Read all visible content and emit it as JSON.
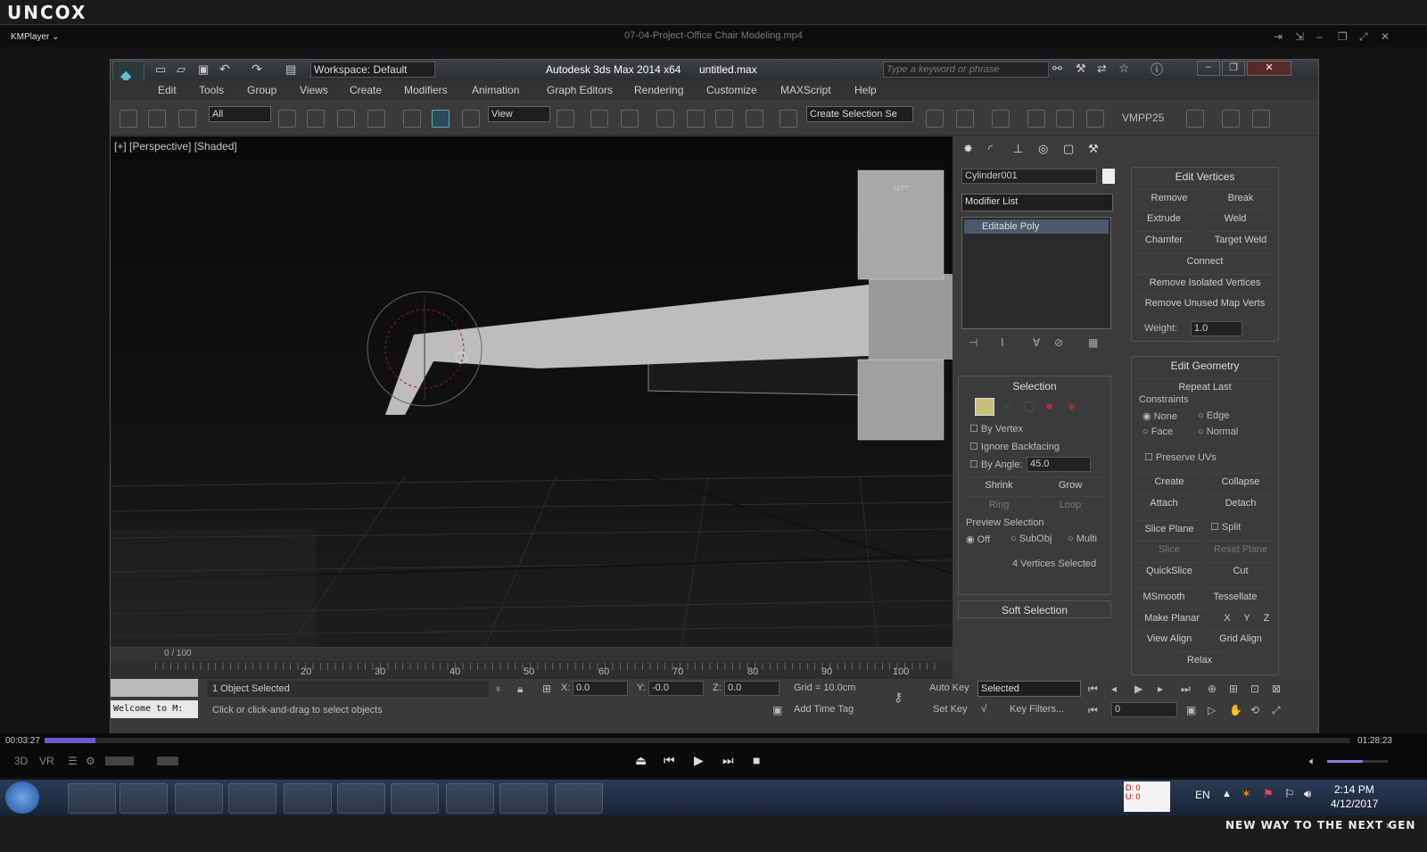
{
  "brand": "uncox",
  "kmplayer": {
    "logo": "KMPlayer",
    "file_title": "07-04-Project-Office Chair Modeling.mp4",
    "time_current": "00:03:27",
    "time_total": "01:28:23",
    "progress": 0.039
  },
  "max": {
    "workspace": "Workspace: Default",
    "title": "Autodesk 3ds Max  2014 x64",
    "filename": "untitled.max",
    "search_placeholder": "Type a keyword or phrase",
    "menus": [
      "Edit",
      "Tools",
      "Group",
      "Views",
      "Create",
      "Modifiers",
      "Animation",
      "Graph Editors",
      "Rendering",
      "Customize",
      "MAXScript",
      "Help"
    ],
    "selection_filter": "All",
    "ref_coord": "View",
    "named_selection": "Create Selection Se",
    "vmpp": "VMPP25"
  },
  "viewport": {
    "label": "[+] [Perspective] [Shaded]",
    "cube_label": "LEFT"
  },
  "cmd": {
    "object_name": "Cylinder001",
    "modifier_list": "Modifier List",
    "stack_item": "Editable Poly",
    "selection": {
      "title": "Selection",
      "by_vertex": "By Vertex",
      "ignore_backfacing": "Ignore Backfacing",
      "by_angle": "By Angle:",
      "angle_value": "45.0",
      "shrink": "Shrink",
      "grow": "Grow",
      "ring": "Ring",
      "loop": "Loop",
      "preview": "Preview Selection",
      "off": "Off",
      "subobj": "SubObj",
      "multi": "Multi",
      "status": "4 Vertices Selected"
    },
    "soft_selection": "Soft Selection",
    "edit_vertices": {
      "title": "Edit Vertices",
      "remove": "Remove",
      "break": "Break",
      "extrude": "Extrude",
      "weld": "Weld",
      "chamfer": "Chamfer",
      "target_weld": "Target Weld",
      "connect": "Connect",
      "remove_isolated": "Remove Isolated Vertices",
      "remove_unused": "Remove Unused Map Verts",
      "weight_label": "Weight:",
      "weight_value": "1.0"
    },
    "edit_geometry": {
      "title": "Edit Geometry",
      "repeat_last": "Repeat Last",
      "constraints": "Constraints",
      "none": "None",
      "edge": "Edge",
      "face": "Face",
      "normal": "Normal",
      "preserve_uvs": "Preserve UVs",
      "create": "Create",
      "collapse": "Collapse",
      "attach": "Attach",
      "detach": "Detach",
      "slice_plane": "Slice Plane",
      "split": "Split",
      "slice": "Slice",
      "reset_plane": "Reset Plane",
      "quickslice": "QuickSlice",
      "cut": "Cut",
      "msmooth": "MSmooth",
      "tessellate": "Tessellate",
      "make_planar": "Make Planar",
      "x": "X",
      "y": "Y",
      "z": "Z",
      "view_align": "View Align",
      "grid_align": "Grid Align",
      "relax": "Relax"
    }
  },
  "timeline": {
    "frame_counter": "0 / 100",
    "ticks": [
      "20",
      "30",
      "40",
      "50",
      "60",
      "70",
      "80",
      "90",
      "100"
    ]
  },
  "status": {
    "maxscript": "Welcome to M:",
    "objects": "1 Object Selected",
    "prompt": "Click or click-and-drag to select objects",
    "x_label": "X:",
    "x": "0.0",
    "y_label": "Y:",
    "y": "-0.0",
    "z_label": "Z:",
    "z": "0.0",
    "grid": "Grid = 10.0cm",
    "add_time_tag": "Add Time Tag",
    "auto_key": "Auto Key",
    "set_key": "Set Key",
    "selected": "Selected",
    "key_filters": "Key Filters...",
    "frame": "0"
  },
  "taskbar": {
    "lang": "EN",
    "time": "2:14 PM",
    "date": "4/12/2017",
    "mini": "D: 0\nU: 0"
  },
  "footer": "NEW WAY TO THE NEXT GEN"
}
